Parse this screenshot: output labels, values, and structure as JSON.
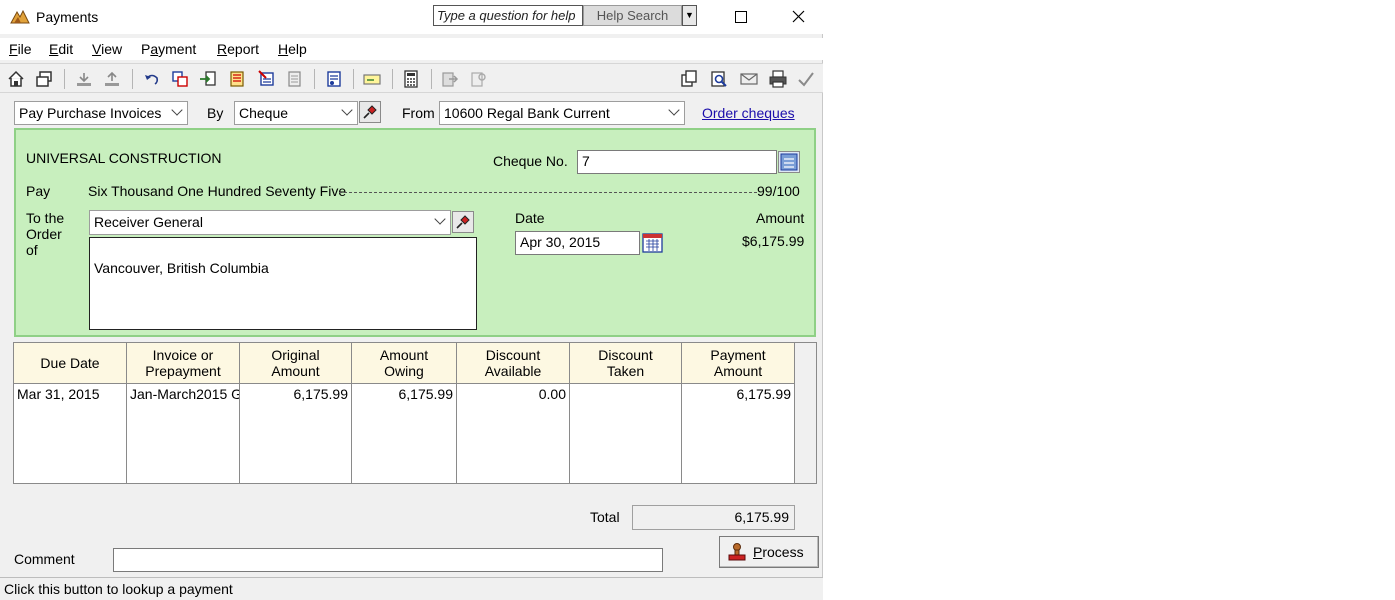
{
  "window": {
    "title": "Payments",
    "help_placeholder": "Type a question for help",
    "help_search_label": "Help Search",
    "minimize_glyph": "☐",
    "close_glyph": "✕"
  },
  "menu": [
    "File",
    "Edit",
    "View",
    "Payment",
    "Report",
    "Help"
  ],
  "menu_underline": [
    "F",
    "E",
    "V",
    "a",
    "R",
    "H"
  ],
  "toolbar_icons": [
    "home-icon",
    "restore-window-icon",
    "save-icon",
    "save-disabled-icon",
    "undo-icon",
    "journal-icon",
    "import-icon",
    "report-icon",
    "invoice-icon",
    "document-icon",
    "recalculate-icon",
    "cheque-icon",
    "calculator-icon",
    "forward-icon",
    "lookup-icon",
    "copy-icon",
    "preview-icon",
    "email-icon",
    "print-icon",
    "checkmark-icon"
  ],
  "options": {
    "payment_type": "Pay Purchase Invoices",
    "by_label": "By",
    "method": "Cheque",
    "from_label": "From",
    "account": "10600 Regal Bank Current",
    "order_cheques_link": "Order cheques"
  },
  "cheque": {
    "company": "UNIVERSAL CONSTRUCTION",
    "cheque_no_label": "Cheque No.",
    "cheque_no": "7",
    "pay_label": "Pay",
    "amount_words": "Six Thousand One Hundred Seventy Five",
    "amount_cents": "99/100",
    "order_of_label_1": "To the",
    "order_of_label_2": "Order",
    "order_of_label_3": "of",
    "payee": "Receiver General",
    "address": "Vancouver, British Columbia",
    "date_label": "Date",
    "date": "Apr 30, 2015",
    "amount_label": "Amount",
    "amount": "$6,175.99"
  },
  "table": {
    "headers": [
      [
        "Due Date"
      ],
      [
        "Invoice or",
        "Prepayment"
      ],
      [
        "Original",
        "Amount"
      ],
      [
        "Amount",
        "Owing"
      ],
      [
        "Discount",
        "Available"
      ],
      [
        "Discount",
        "Taken"
      ],
      [
        "Payment",
        "Amount"
      ]
    ],
    "rows": [
      [
        "Mar 31, 2015",
        "Jan-March2015 G",
        "6,175.99",
        "6,175.99",
        "0.00",
        "",
        "6,175.99"
      ]
    ]
  },
  "footer": {
    "total_label": "Total",
    "total": "6,175.99",
    "comment_label": "Comment",
    "comment": "",
    "process_label": "Process",
    "process_underline": "P",
    "status": "Click this button to lookup a payment"
  }
}
